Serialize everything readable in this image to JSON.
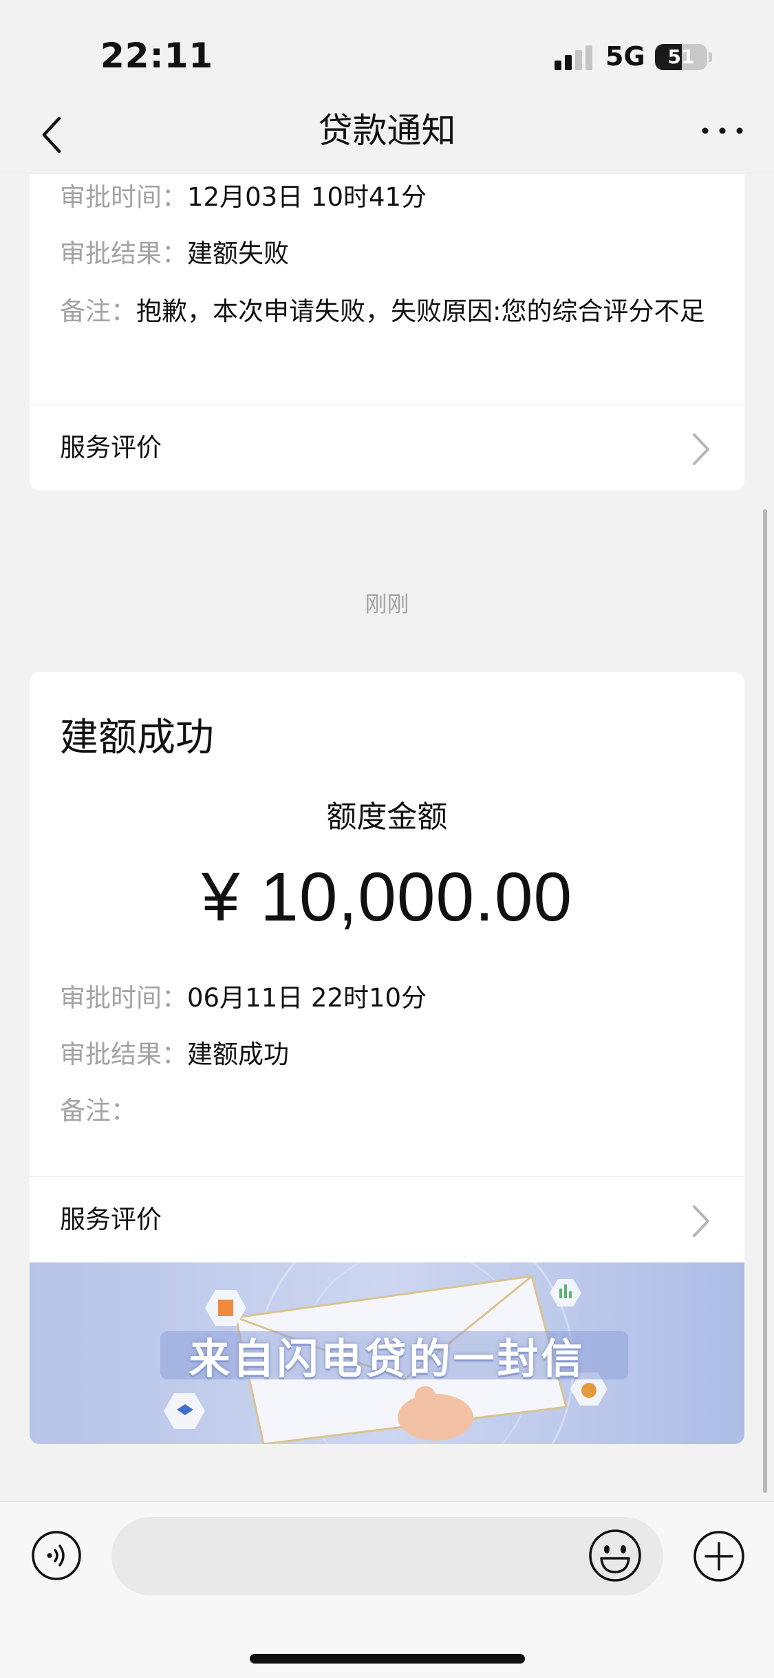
{
  "status_bar": {
    "time": "22:11",
    "network": "5G",
    "battery_level": "51"
  },
  "nav": {
    "title": "贷款通知",
    "more_label": "···"
  },
  "messages": [
    {
      "approval_time_label": "审批时间：",
      "approval_time": "12月03日 10时41分",
      "approval_result_label": "审批结果：",
      "approval_result": "建额失败",
      "remark_label": "备注：",
      "remark": "抱歉，本次申请失败，失败原因:您的综合评分不足",
      "service_label": "服务评价"
    },
    {
      "title": "建额成功",
      "amount_label": "额度金额",
      "amount": "¥ 10,000.00",
      "approval_time_label": "审批时间：",
      "approval_time": "06月11日 22时10分",
      "approval_result_label": "审批结果：",
      "approval_result": "建额成功",
      "remark_label": "备注：",
      "service_label": "服务评价",
      "banner_text": "来自闪电贷的一封信"
    }
  ],
  "timestamp": "刚刚",
  "input": {
    "placeholder": ""
  },
  "colors": {
    "background": "#f2f2f2",
    "card": "#ffffff",
    "label_gray": "#a3a3a3",
    "banner_blue": "#c3cdee"
  }
}
